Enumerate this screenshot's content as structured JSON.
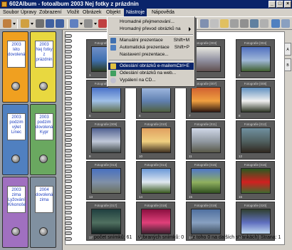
{
  "window": {
    "title": "602Album - fotoalbum 2003 Nej fotky z prázdnin"
  },
  "menubar": [
    "Soubor",
    "Úpravy",
    "Zobrazení",
    "Vložit",
    "Obrázek",
    "Objekt",
    "Nástroje",
    "Nápověda"
  ],
  "menu_active": "Nástroje",
  "dropdown": [
    {
      "label": "Hromadné přejmenování...",
      "shortcut": "",
      "submenu": false
    },
    {
      "label": "Hromadný převod obrázků na",
      "shortcut": "",
      "submenu": true
    },
    {
      "label": "Manuální prezentace",
      "shortcut": "Shift+M",
      "submenu": false
    },
    {
      "label": "Automatická prezentace",
      "shortcut": "Shift+P",
      "submenu": false
    },
    {
      "label": "Nastavení prezentace...",
      "shortcut": "",
      "submenu": false
    },
    {
      "label": "Odeslání obrázků e-mailem...",
      "shortcut": "Ctrl+E",
      "submenu": false,
      "highlighted": true
    },
    {
      "label": "Odeslání obrázků na web...",
      "shortcut": "",
      "submenu": false
    },
    {
      "label": "Vypálení na CD...",
      "shortcut": "",
      "submenu": false
    }
  ],
  "binders": [
    {
      "label": "2003 léto dovolená",
      "color": "#f0a020"
    },
    {
      "label": "2003 Nej fotky z prázdnin",
      "color": "#e8d840"
    },
    {
      "label": "2003 podzim výlet Linec",
      "color": "#5080c0"
    },
    {
      "label": "2003 podzim dovolená Kypr",
      "color": "#6aa860"
    },
    {
      "label": "2003 zima Lyžování Krkonoše",
      "color": "#a070c0"
    },
    {
      "label": "2004 dovolená zima",
      "color": "#8090a0"
    }
  ],
  "photos": [
    {
      "caption": "Fotografie [001]",
      "num": "1",
      "colors": [
        "#7090c8",
        "#4070b0",
        "#2a3a20"
      ]
    },
    {
      "caption": "Fotografie [002]",
      "num": "2",
      "colors": [
        "#5a7090",
        "#8aa0c0",
        "#304040"
      ]
    },
    {
      "caption": "Fotografie [003]",
      "num": "3",
      "colors": [
        "#e8e8e0",
        "#9090a0",
        "#605050"
      ]
    },
    {
      "caption": "Fotografie [004]",
      "num": "4",
      "colors": [
        "#5070c0",
        "#a0b8d8",
        "#406030"
      ]
    },
    {
      "caption": "Fotografie [005]",
      "num": "5",
      "colors": [
        "#4870c8",
        "#a0c0e8",
        "#607050"
      ]
    },
    {
      "caption": "Fotografie [006]",
      "num": "6",
      "colors": [
        "#a0b8e0",
        "#6080b0",
        "#506040"
      ]
    },
    {
      "caption": "Fotografie [007]",
      "num": "7",
      "colors": [
        "#d06030",
        "#f0a040",
        "#301810"
      ]
    },
    {
      "caption": "Fotografie [008]",
      "num": "8",
      "colors": [
        "#6090c0",
        "#f0f0f0",
        "#303828"
      ]
    },
    {
      "caption": "Fotografie [009]",
      "num": "9",
      "colors": [
        "#506090",
        "#c0c8d8",
        "#404848"
      ]
    },
    {
      "caption": "Fotografie [010]",
      "num": "10",
      "colors": [
        "#e0a060",
        "#f0d080",
        "#403020"
      ]
    },
    {
      "caption": "Fotografie [011]",
      "num": "11",
      "colors": [
        "#d0d8e8",
        "#9098a0",
        "#585848"
      ]
    },
    {
      "caption": "Fotografie [012]",
      "num": "12",
      "colors": [
        "#7090a0",
        "#506060",
        "#302820"
      ]
    },
    {
      "caption": "Fotografie [013]",
      "num": "13",
      "colors": [
        "#4870c0",
        "#8090a8",
        "#6a7060"
      ]
    },
    {
      "caption": "Fotografie [014]",
      "num": "14",
      "colors": [
        "#6a98d8",
        "#e0e8f0",
        "#3a5a20"
      ]
    },
    {
      "caption": "Fotografie [015]",
      "num": "15",
      "colors": [
        "#5078c8",
        "#90b060",
        "#305020"
      ]
    },
    {
      "caption": "Fotografie [016]",
      "num": "16",
      "colors": [
        "#2a5a20",
        "#d02020",
        "#406a30"
      ]
    },
    {
      "caption": "Fotografie [017]",
      "num": "17",
      "colors": [
        "#204040",
        "#507060",
        "#102020"
      ]
    },
    {
      "caption": "Fotografie [018]",
      "num": "18",
      "colors": [
        "#8a1040",
        "#e0407a",
        "#402030"
      ]
    },
    {
      "caption": "Fotografie [019]",
      "num": "19",
      "colors": [
        "#5070a0",
        "#88a0c0",
        "#405060"
      ]
    },
    {
      "caption": "Fotografie [020]",
      "num": "20",
      "colors": [
        "#304030",
        "#6070c0",
        "#c0d8f0"
      ]
    }
  ],
  "status": {
    "count": "počet snímků: 61",
    "selected": "vybraných snímků: 0",
    "other_pages": "(z toho 0 na dalších stránkách)",
    "page": "Strana: 1"
  },
  "tab_labels": [
    "A",
    "B"
  ]
}
